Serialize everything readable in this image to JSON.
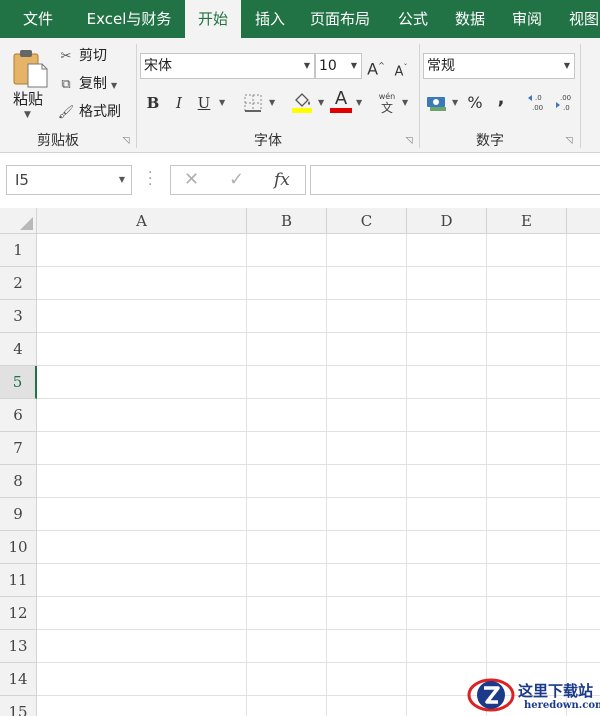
{
  "tabs": [
    {
      "label": "文件"
    },
    {
      "label": "Excel与财务"
    },
    {
      "label": "开始"
    },
    {
      "label": "插入"
    },
    {
      "label": "页面布局"
    },
    {
      "label": "公式"
    },
    {
      "label": "数据"
    },
    {
      "label": "审阅"
    },
    {
      "label": "视图"
    }
  ],
  "active_tab": "开始",
  "clipboard": {
    "paste_label": "粘贴",
    "cut_label": "剪切",
    "copy_label": "复制",
    "format_painter_label": "格式刷",
    "group_label": "剪贴板"
  },
  "font": {
    "font_name": "宋体",
    "font_size": "10",
    "group_label": "字体",
    "bold": "B",
    "italic": "I",
    "underline": "U",
    "grow_font": "A",
    "shrink_font": "A",
    "font_color_letter": "A",
    "phonetic": "wén",
    "phonetic_char": "文",
    "fill_color": "#ffff00",
    "font_color": "#e00000"
  },
  "number": {
    "format": "常规",
    "group_label": "数字",
    "percent": "%",
    "comma": ","
  },
  "formula_bar": {
    "name_box": "I5",
    "cancel": "✕",
    "enter": "✓",
    "fx": "fx",
    "value": ""
  },
  "columns": [
    "A",
    "B",
    "C",
    "D",
    "E"
  ],
  "rows": [
    "1",
    "2",
    "3",
    "4",
    "5",
    "6",
    "7",
    "8",
    "9",
    "10",
    "11",
    "12",
    "13",
    "14",
    "15"
  ],
  "selected_row": "5",
  "watermark": {
    "title": "这里下载站",
    "url": "heredown.com"
  },
  "colors": {
    "accent": "#217346",
    "ribbon_bg": "#f3f3f3",
    "gridline": "#e1e1e1",
    "watermark": "#1c3a8a"
  }
}
